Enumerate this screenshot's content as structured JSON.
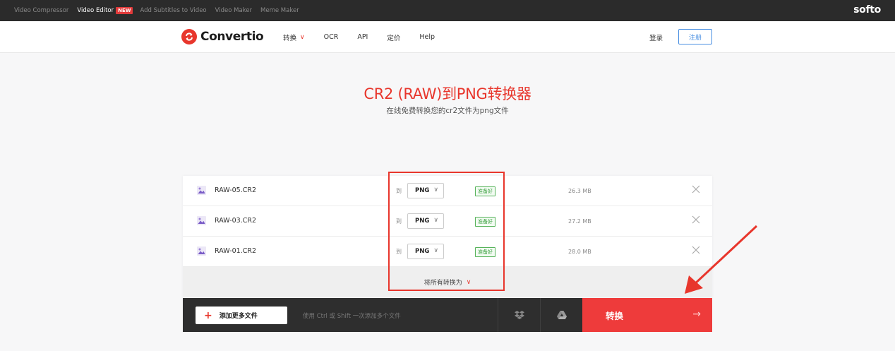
{
  "topbar": {
    "links": [
      {
        "label": "Video Compressor",
        "active": false
      },
      {
        "label": "Video Editor",
        "active": true,
        "badge": "NEW"
      },
      {
        "label": "Add Subtitles to Video",
        "active": false
      },
      {
        "label": "Video Maker",
        "active": false
      },
      {
        "label": "Meme Maker",
        "active": false
      }
    ],
    "brand": "softo"
  },
  "navbar": {
    "logo": "Convertio",
    "items": [
      "转换",
      "OCR",
      "API",
      "定价",
      "Help"
    ],
    "login": "登录",
    "register": "注册"
  },
  "hero": {
    "title": "CR2 (RAW)到PNG转换器",
    "subtitle": "在线免费转换您的cr2文件为png文件"
  },
  "files": {
    "to_label": "到",
    "rows": [
      {
        "name": "RAW-05.CR2",
        "format": "PNG",
        "status": "准备好",
        "size": "26.3 MB"
      },
      {
        "name": "RAW-03.CR2",
        "format": "PNG",
        "status": "准备好",
        "size": "27.2 MB"
      },
      {
        "name": "RAW-01.CR2",
        "format": "PNG",
        "status": "准备好",
        "size": "28.0 MB"
      }
    ],
    "convert_all": "将所有转换为"
  },
  "actions": {
    "add_more": "添加更多文件",
    "hint": "使用 Ctrl 或 Shift 一次添加多个文件",
    "convert": "转换"
  },
  "colors": {
    "brand_red": "#e8362c",
    "ready_green": "#3aa03f",
    "link_blue": "#4a90e2",
    "dark_bar": "#2b2b2b"
  }
}
